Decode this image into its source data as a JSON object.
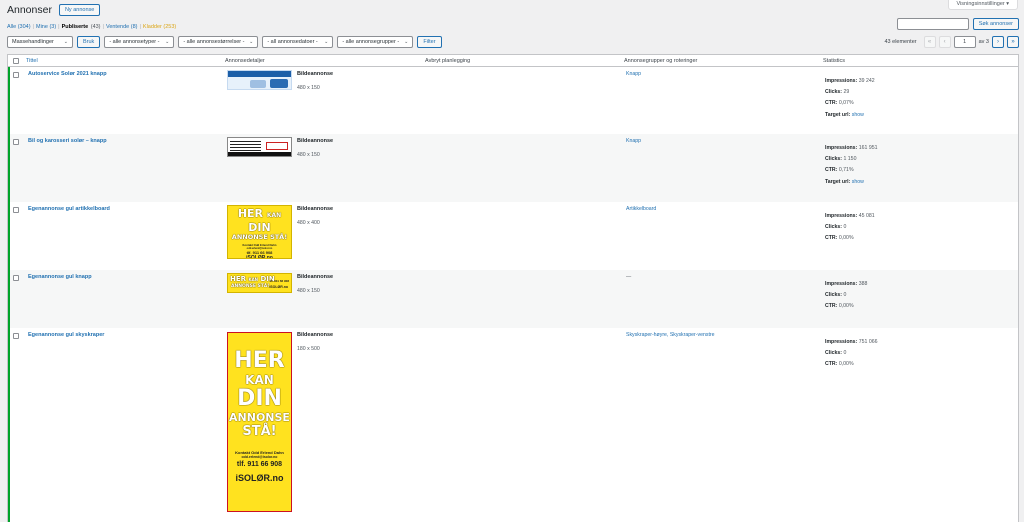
{
  "screen_options": "Visningsinnstillinger ▾",
  "header": {
    "title": "Annonser",
    "new_button": "Ny annonse"
  },
  "views": [
    {
      "label": "Alle",
      "count": "(304)"
    },
    {
      "label": "Mine",
      "count": "(3)"
    },
    {
      "label": "Publiserte",
      "count": "(43)"
    },
    {
      "label": "Ventende",
      "count": "(8)"
    },
    {
      "label": "Kladder",
      "count": "(253)"
    }
  ],
  "search": {
    "button": "Søk annonser"
  },
  "tablenav": {
    "bulk": "Massehandlinger",
    "apply": "Bruk",
    "filter_types": "- alle annonsetyper -",
    "filter_sizes": "- alle annonsestørrelser -",
    "filter_dates": "- all annonsedatoer -",
    "filter_groups": "- alle annonsegrupper -",
    "filter_button": "Filter",
    "count": "43 elementer",
    "first": "«",
    "prev": "‹",
    "page": "1",
    "of": "av 3",
    "next": "›",
    "last": "»"
  },
  "columns": {
    "title": "Tittel",
    "details": "Annonsedetaljer",
    "schedule": "Avbryt planlegging",
    "groups": "Annonsegrupper og roteringer",
    "stats": "Statistics"
  },
  "labels": {
    "impressions": "Impressions:",
    "clicks": "Clicks:",
    "ctr": "CTR:",
    "target": "Target url:",
    "show": "show"
  },
  "rows": [
    {
      "title": "Autoservice Solør 2021 knapp",
      "type": "Bildeannonse",
      "size": "480 x 150",
      "groups": "Knapp",
      "impressions": "39 242",
      "clicks": "29",
      "ctr": "0,07%"
    },
    {
      "title": "Bil og karosseri solør – knapp",
      "type": "Bildeannonse",
      "size": "480 x 150",
      "groups": "Knapp",
      "impressions": "161 951",
      "clicks": "1 150",
      "ctr": "0,71%"
    },
    {
      "title": "Egenannonse gul artikkelboard",
      "type": "Bildeannonse",
      "size": "480 x 400",
      "groups": "Artikkelboard",
      "impressions": "45 081",
      "clicks": "0",
      "ctr": "0,00%"
    },
    {
      "title": "Egenannonse gul knapp",
      "type": "Bildeannonse",
      "size": "480 x 150",
      "groups": "—",
      "impressions": "388",
      "clicks": "0",
      "ctr": "0,00%"
    },
    {
      "title": "Egenannonse gul skyskraper",
      "type": "Bildeannonse",
      "size": "180 x 500",
      "groups": "Skyskraper-høyre, Skyskraper-venstre",
      "impressions": "751 066",
      "clicks": "0",
      "ctr": "0,00%"
    }
  ],
  "ad_banner": {
    "her": "HER",
    "kan": "KAN",
    "din": "DIN",
    "annonse": "ANNONSE",
    "sta": "STÅ!",
    "contact": "Kontakt Odd Erlend Dahn",
    "email": "odd.erlend@isolor.no",
    "phone": "tlf. 911 66 908",
    "logo": "iSOLØR.no"
  }
}
